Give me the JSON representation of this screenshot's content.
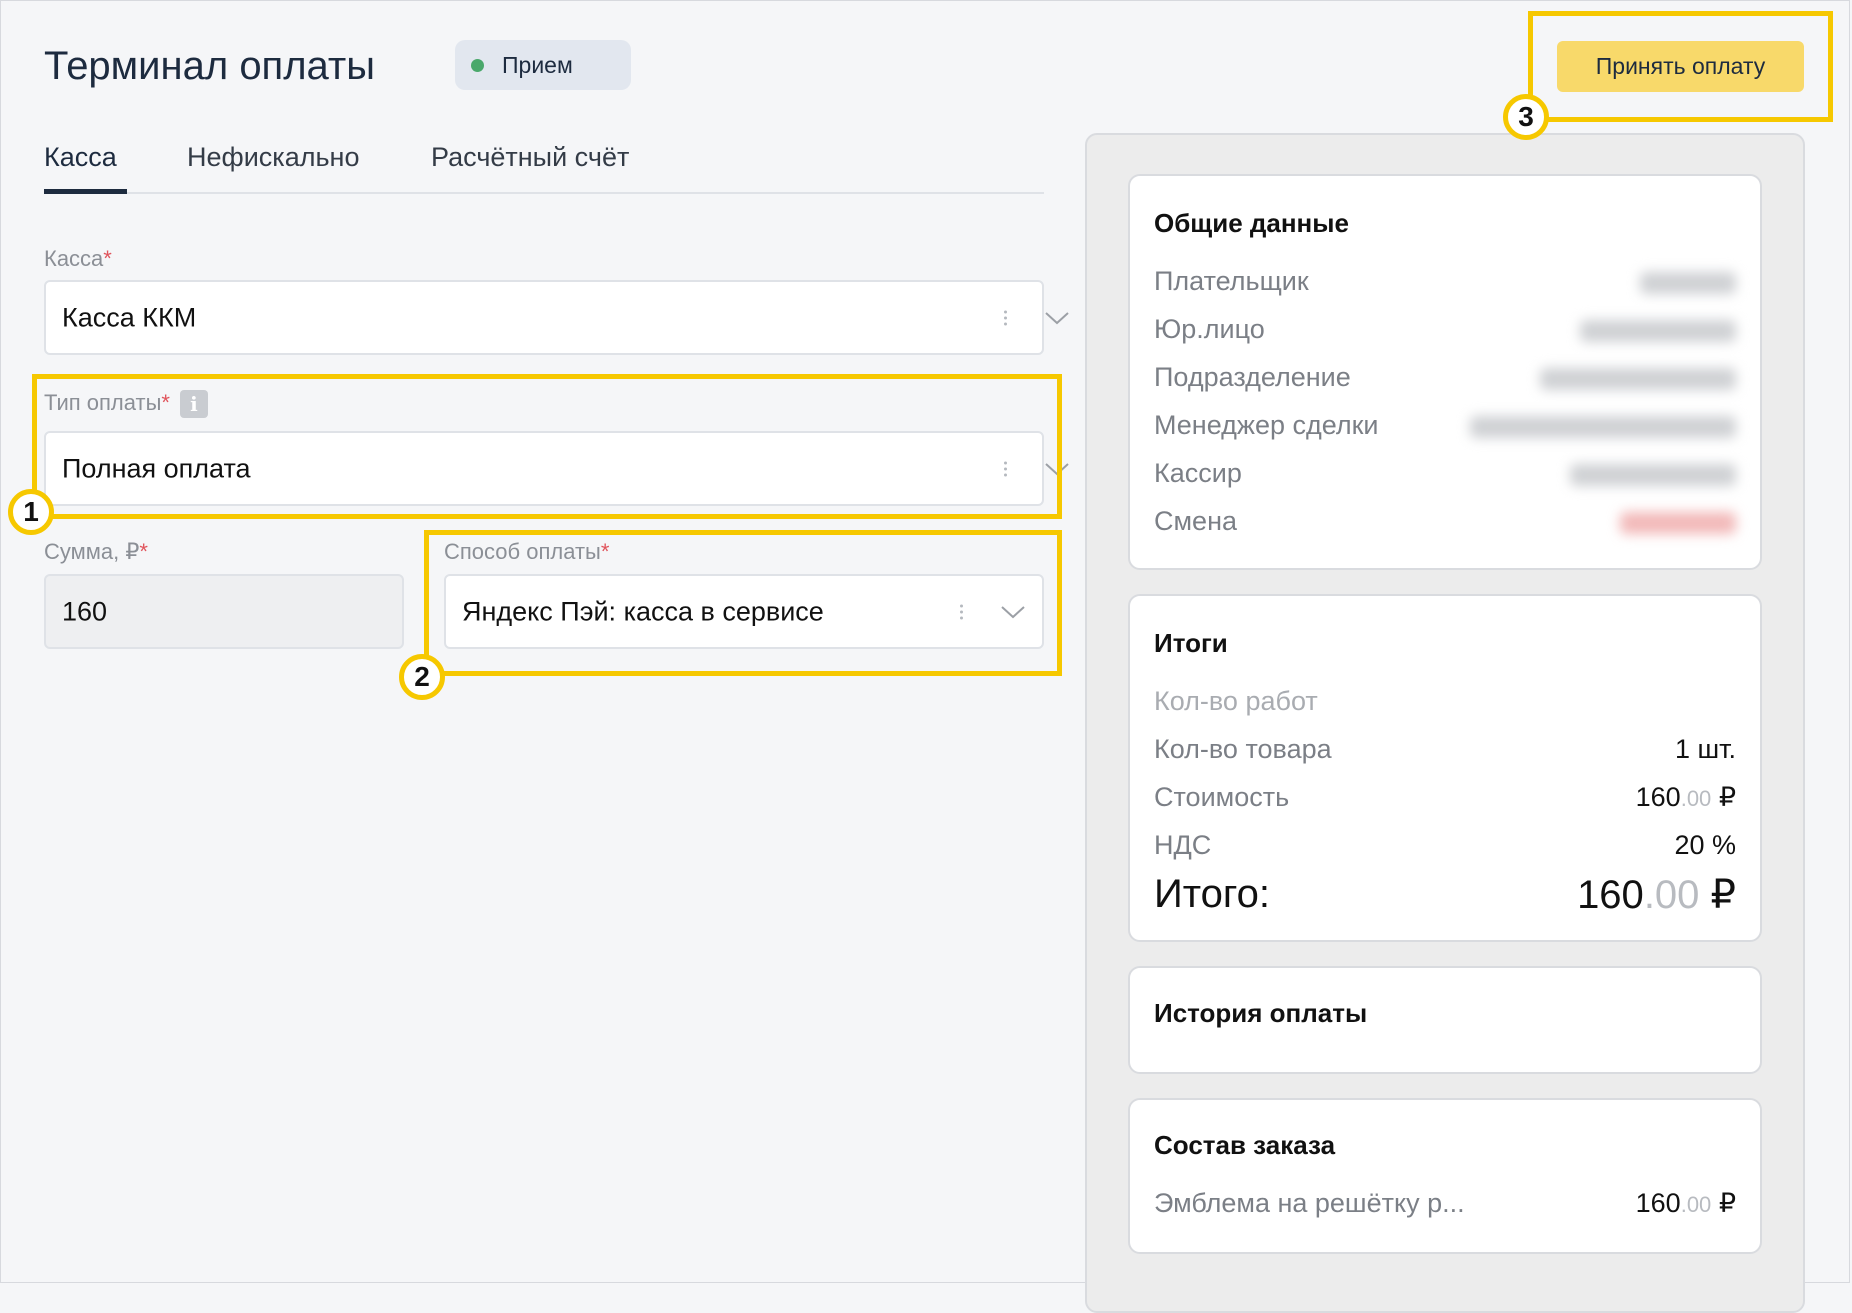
{
  "header": {
    "title": "Терминал оплаты",
    "status": "Прием",
    "accept_button": "Принять оплату"
  },
  "tabs": [
    {
      "label": "Касса",
      "active": true
    },
    {
      "label": "Нефискально",
      "active": false
    },
    {
      "label": "Расчётный счёт",
      "active": false
    }
  ],
  "form": {
    "register": {
      "label": "Касса",
      "required": "*",
      "value": "Касса ККМ"
    },
    "payment_type": {
      "label": "Тип оплаты",
      "required": "*",
      "info": "i",
      "value": "Полная оплата"
    },
    "amount": {
      "label": "Сумма, ₽",
      "required": "*",
      "value": "160"
    },
    "payment_method": {
      "label": "Способ оплаты",
      "required": "*",
      "value": "Яндекс Пэй: касса в сервисе"
    }
  },
  "steps": [
    "1",
    "2",
    "3"
  ],
  "general": {
    "title": "Общие данные",
    "rows": [
      {
        "label": "Плательщик"
      },
      {
        "label": "Юр.лицо"
      },
      {
        "label": "Подразделение"
      },
      {
        "label": "Менеджер сделки"
      },
      {
        "label": "Кассир"
      },
      {
        "label": "Смена"
      }
    ]
  },
  "totals": {
    "title": "Итоги",
    "works_label": "Кол-во работ",
    "goods_label": "Кол-во товара",
    "goods_value": "1 шт.",
    "cost_label": "Стоимость",
    "cost_int": "160",
    "cost_cents": ".00",
    "currency": "₽",
    "vat_label": "НДС",
    "vat_value": "20 %",
    "total_label": "Итого:",
    "total_int": "160",
    "total_cents": ".00"
  },
  "history": {
    "title": "История оплаты"
  },
  "order": {
    "title": "Состав заказа",
    "item_label": "Эмблема на решётку р...",
    "item_int": "160",
    "item_cents": ".00"
  },
  "colors": {
    "highlight": "#f6c800",
    "accent_button": "#f8d96a",
    "status_dot": "#4aa86b",
    "required": "#e0545c"
  }
}
